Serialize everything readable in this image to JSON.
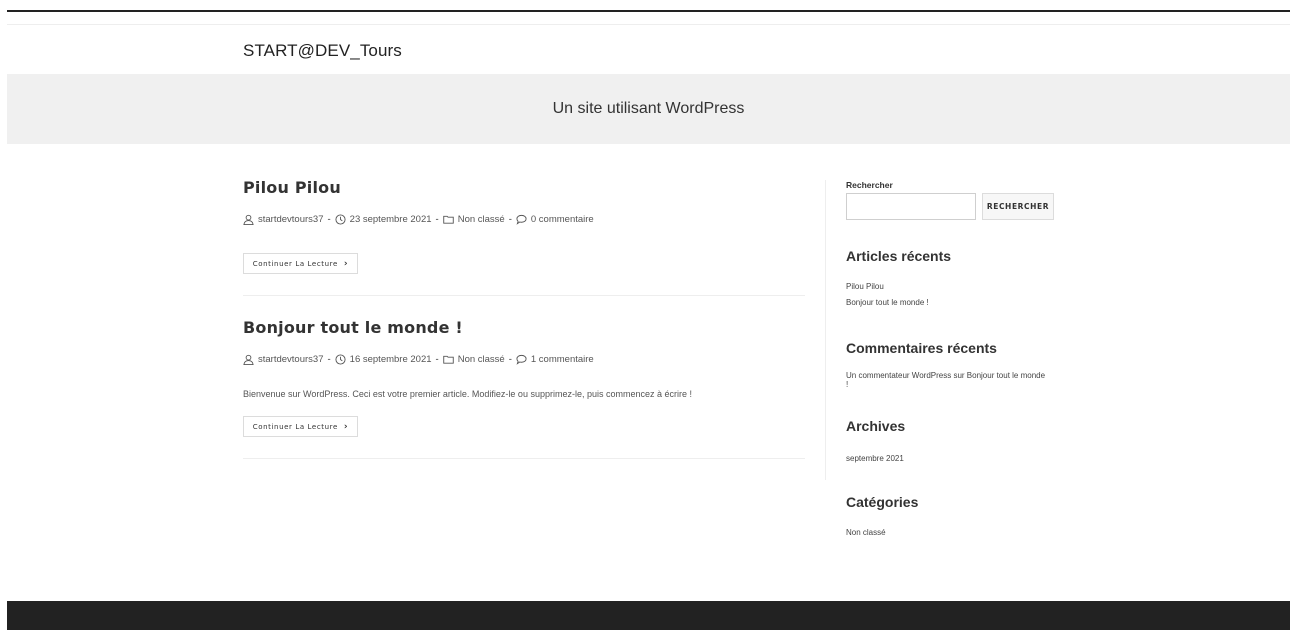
{
  "site": {
    "title": "START@DEV_Tours",
    "tagline": "Un site utilisant WordPress"
  },
  "posts": [
    {
      "title": "Pilou Pilou",
      "author": "startdevtours37",
      "date": "23 septembre 2021",
      "category": "Non classé",
      "comments": "0 commentaire",
      "excerpt": "",
      "more_label": "Continuer La Lecture"
    },
    {
      "title": "Bonjour tout le monde !",
      "author": "startdevtours37",
      "date": "16 septembre 2021",
      "category": "Non classé",
      "comments": "1 commentaire",
      "excerpt": "Bienvenue sur WordPress. Ceci est votre premier article. Modifiez-le ou supprimez-le, puis commencez à écrire !",
      "more_label": "Continuer La Lecture"
    }
  ],
  "meta_separator": "-",
  "sidebar": {
    "search": {
      "label": "Rechercher",
      "value": "",
      "button_label": "RECHERCHER"
    },
    "recent_posts": {
      "title": "Articles récents",
      "items": [
        "Pilou Pilou",
        "Bonjour tout le monde !"
      ]
    },
    "recent_comments": {
      "title": "Commentaires récents",
      "items": [
        "Un commentateur WordPress sur Bonjour tout le monde !"
      ]
    },
    "archives": {
      "title": "Archives",
      "items": [
        "septembre 2021"
      ]
    },
    "categories": {
      "title": "Catégories",
      "items": [
        "Non classé"
      ]
    }
  },
  "icons": {
    "author": "user-icon",
    "date": "clock-icon",
    "category": "folder-icon",
    "comments": "comment-icon",
    "more": "chevron-right-icon"
  },
  "colors": {
    "header_band": "#f0f0f0",
    "footer": "#222222",
    "text": "#333333"
  }
}
